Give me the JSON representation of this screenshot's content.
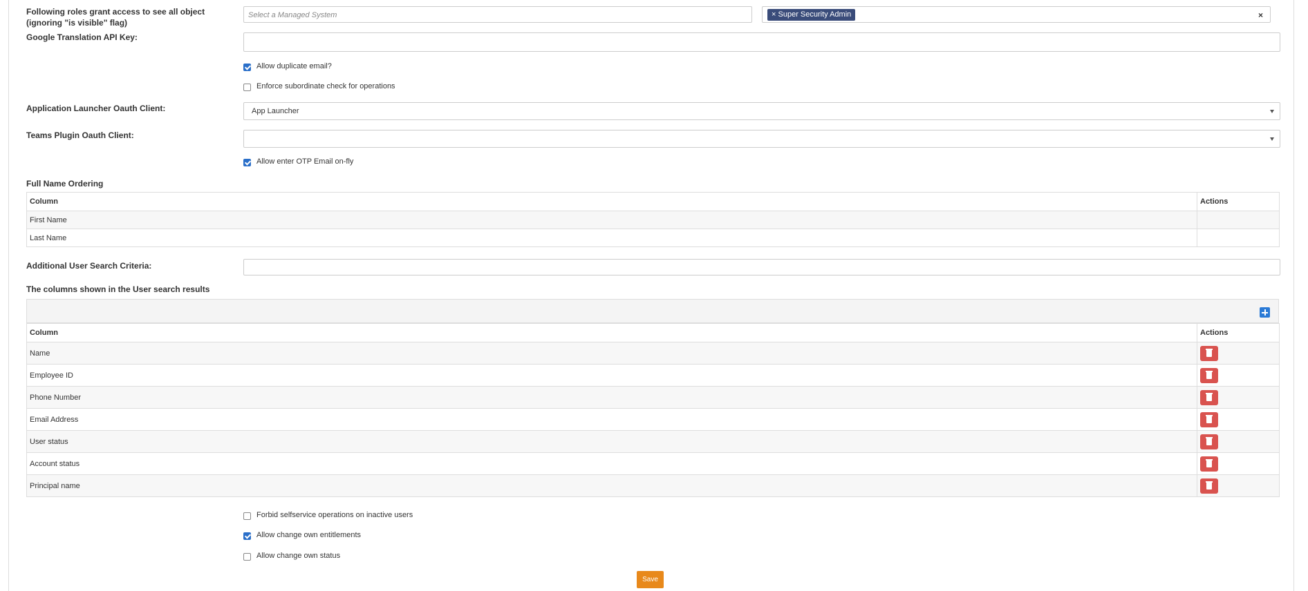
{
  "roles": {
    "label": "Following roles grant access to see all object (ignoring \"is visible\" flag)",
    "managed_system_placeholder": "Select a Managed System",
    "selected_tag": "Super Security Admin",
    "clear_symbol": "×",
    "tag_remove_symbol": "×"
  },
  "google_api": {
    "label": "Google Translation API Key:",
    "value": ""
  },
  "checks1": [
    {
      "label": "Allow duplicate email?",
      "checked": true
    },
    {
      "label": "Enforce subordinate check for operations",
      "checked": false
    }
  ],
  "app_launcher": {
    "label": "Application Launcher Oauth Client:",
    "value": "App Launcher"
  },
  "teams_plugin": {
    "label": "Teams Plugin Oauth Client:",
    "value": ""
  },
  "otp_check": {
    "label": "Allow enter OTP Email on-fly",
    "checked": true
  },
  "full_name": {
    "title": "Full Name Ordering",
    "headers": [
      "Column",
      "Actions"
    ],
    "rows": [
      "First Name",
      "Last Name"
    ]
  },
  "additional_search": {
    "label": "Additional User Search Criteria:",
    "value": ""
  },
  "user_search": {
    "title": "The columns shown in the User search results",
    "headers": [
      "Column",
      "Actions"
    ],
    "rows": [
      "Name",
      "Employee ID",
      "Phone Number",
      "Email Address",
      "User status",
      "Account status",
      "Principal name"
    ]
  },
  "checks2": [
    {
      "label": "Forbid selfservice operations on inactive users",
      "checked": false
    },
    {
      "label": "Allow change own entitlements",
      "checked": true
    },
    {
      "label": "Allow change own status",
      "checked": false
    }
  ],
  "save_label": "Save",
  "colors": {
    "accent": "#2a6fc9",
    "danger": "#d9534f",
    "save": "#e8891b",
    "tag": "#3a4c7a"
  }
}
